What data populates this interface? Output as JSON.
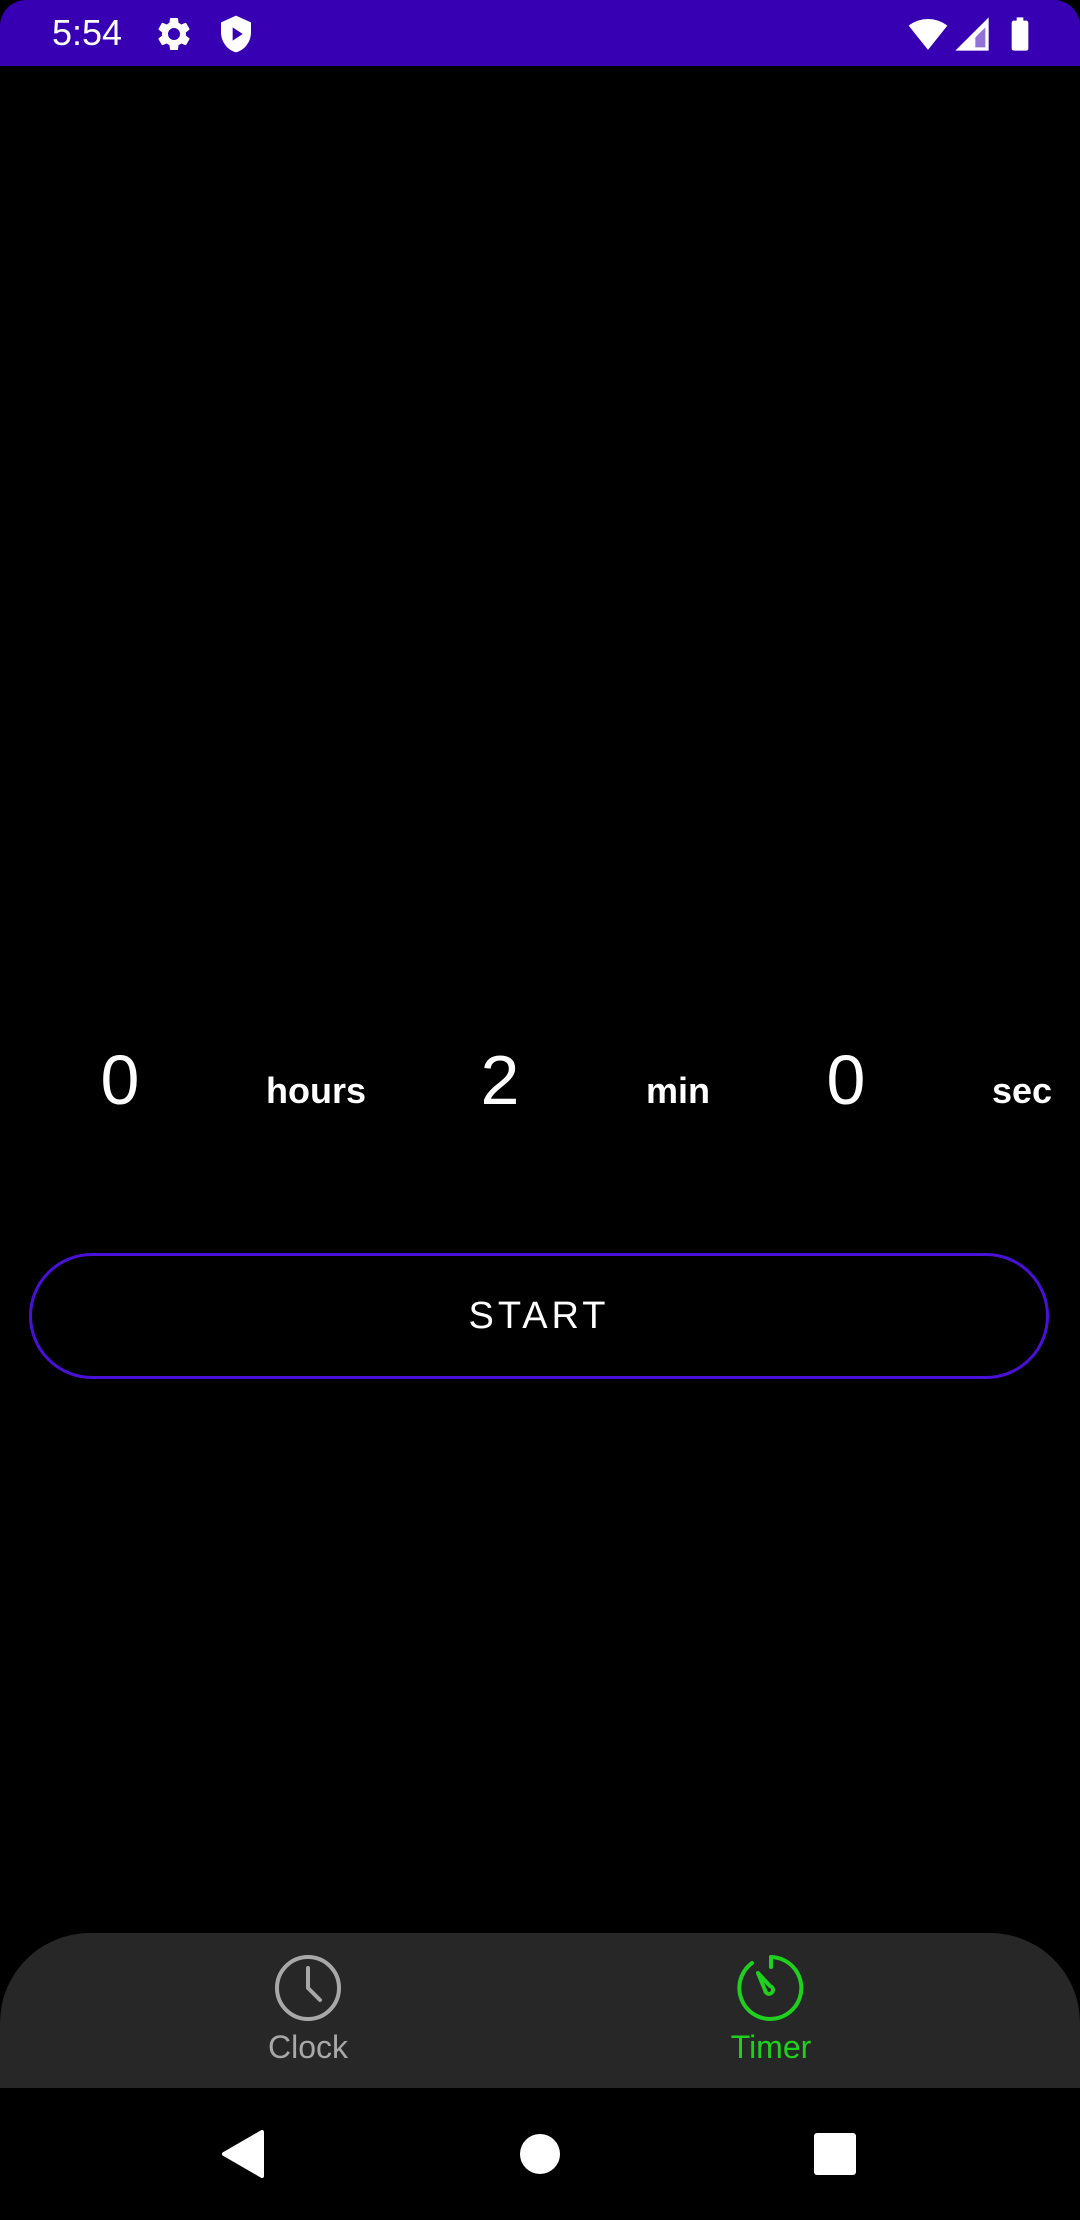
{
  "status_bar": {
    "time": "5:54",
    "background_color": "#3700b3",
    "left_icons": [
      "gear-icon",
      "shield-play-icon"
    ],
    "right_icons": [
      "wifi-icon",
      "cell-signal-icon",
      "battery-icon"
    ]
  },
  "timer_picker": {
    "hours_value": "0",
    "hours_unit": "hours",
    "minutes_value": "2",
    "minutes_unit": "min",
    "seconds_value": "0",
    "seconds_unit": "sec"
  },
  "start_button": {
    "label": "START",
    "border_color": "#4a10d8"
  },
  "bottom_nav": {
    "background_color": "#272727",
    "items": [
      {
        "label": "Clock",
        "icon": "clock-icon",
        "color": "#a8a8a8",
        "selected": false
      },
      {
        "label": "Timer",
        "icon": "stopwatch-icon",
        "color": "#1fd01f",
        "selected": true
      }
    ]
  },
  "system_nav": {
    "buttons": [
      "back-icon",
      "home-icon",
      "recents-icon"
    ]
  }
}
